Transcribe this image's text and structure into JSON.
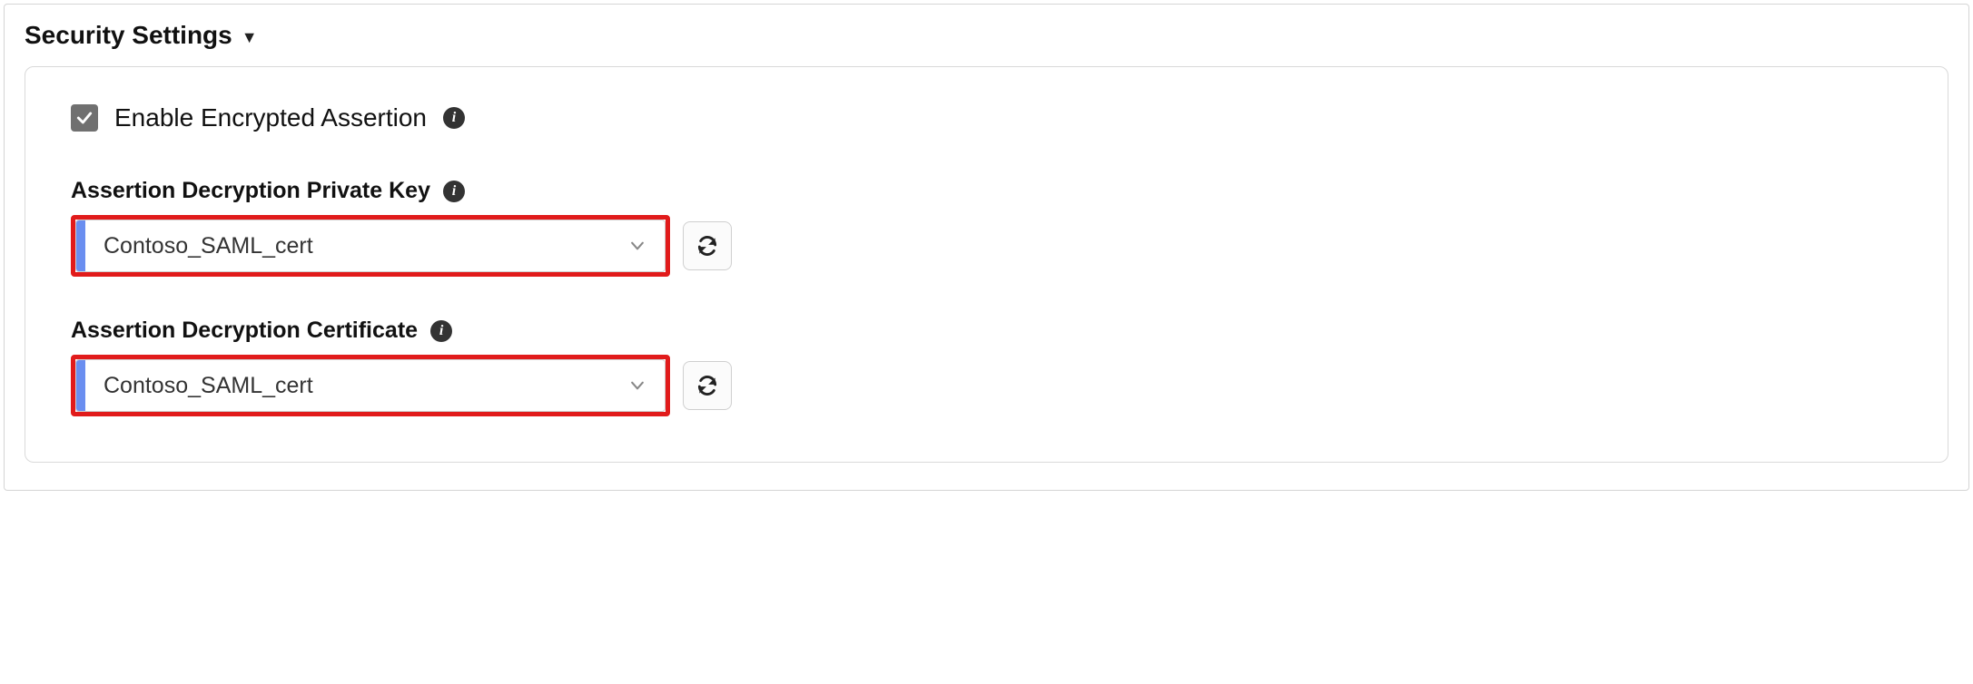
{
  "section": {
    "title": "Security Settings"
  },
  "enable_encrypted": {
    "label": "Enable Encrypted Assertion",
    "checked": true
  },
  "private_key": {
    "label": "Assertion Decryption Private Key",
    "value": "Contoso_SAML_cert"
  },
  "certificate": {
    "label": "Assertion Decryption Certificate",
    "value": "Contoso_SAML_cert"
  },
  "colors": {
    "highlight": "#e11b1b",
    "accent": "#6a8ef0",
    "checkbox": "#707070"
  }
}
